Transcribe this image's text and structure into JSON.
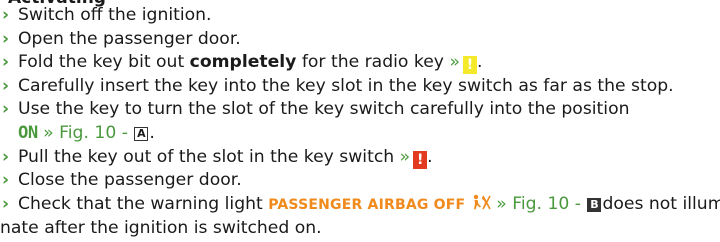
{
  "heading_partial": "Activating",
  "steps": [
    {
      "text": "Switch off the ignition."
    },
    {
      "text": "Open the passenger door."
    },
    {
      "pre": "Fold the key bit out ",
      "bold": "completely",
      "post": " for the radio key ",
      "ref": "»",
      "badge": "!"
    },
    {
      "text": "Carefully insert the key into the key slot in the key switch as far as the stop."
    },
    {
      "text": "Use the key to turn the slot of the key switch carefully into the position"
    },
    {
      "on_label": "ON",
      "ref": "» Fig. 10 -",
      "box": "A",
      "tail": "."
    },
    {
      "pre": "Pull the key out of the slot in the key switch ",
      "ref": "»",
      "badge": "!",
      "post": "."
    },
    {
      "text": "Close the passenger door."
    },
    {
      "pre": "Check that the warning light ",
      "warning": "PASSENGER AIRBAG OFF",
      "ref": "» Fig. 10 -",
      "box": "B",
      "post": "does not illumi-"
    },
    {
      "text": "nate after the ignition is switched on."
    }
  ],
  "colors": {
    "arrow": "#4a9a3d",
    "reference": "#4a9a3d",
    "warning_text": "#f08a1c",
    "notice_badge": "#f5ea2a",
    "caution_badge": "#e23b1f"
  },
  "icons": {
    "bullet": "chevron-right-icon",
    "airbag": "passenger-airbag-off-icon"
  }
}
